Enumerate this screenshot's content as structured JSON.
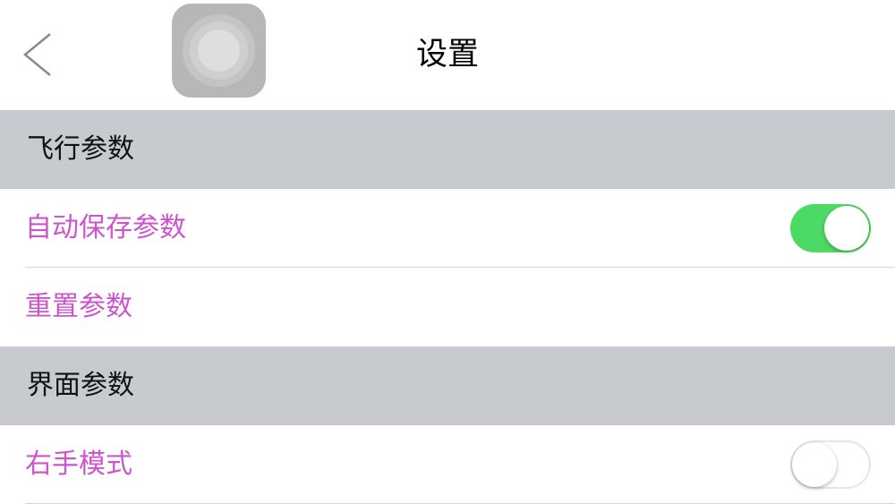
{
  "nav": {
    "title": "设置",
    "back_icon": "chevron-left-icon",
    "assistive_icon": "assistive-touch-icon"
  },
  "sections": {
    "flight": {
      "header": "飞行参数",
      "auto_save_label": "自动保存参数",
      "auto_save_on": true,
      "reset_label": "重置参数"
    },
    "ui": {
      "header": "界面参数",
      "right_hand_label": "右手模式",
      "right_hand_on": false
    }
  },
  "colors": {
    "accent_label": "#cc55cc",
    "toggle_on": "#4cd964",
    "section_bg": "#c7cbd0"
  }
}
